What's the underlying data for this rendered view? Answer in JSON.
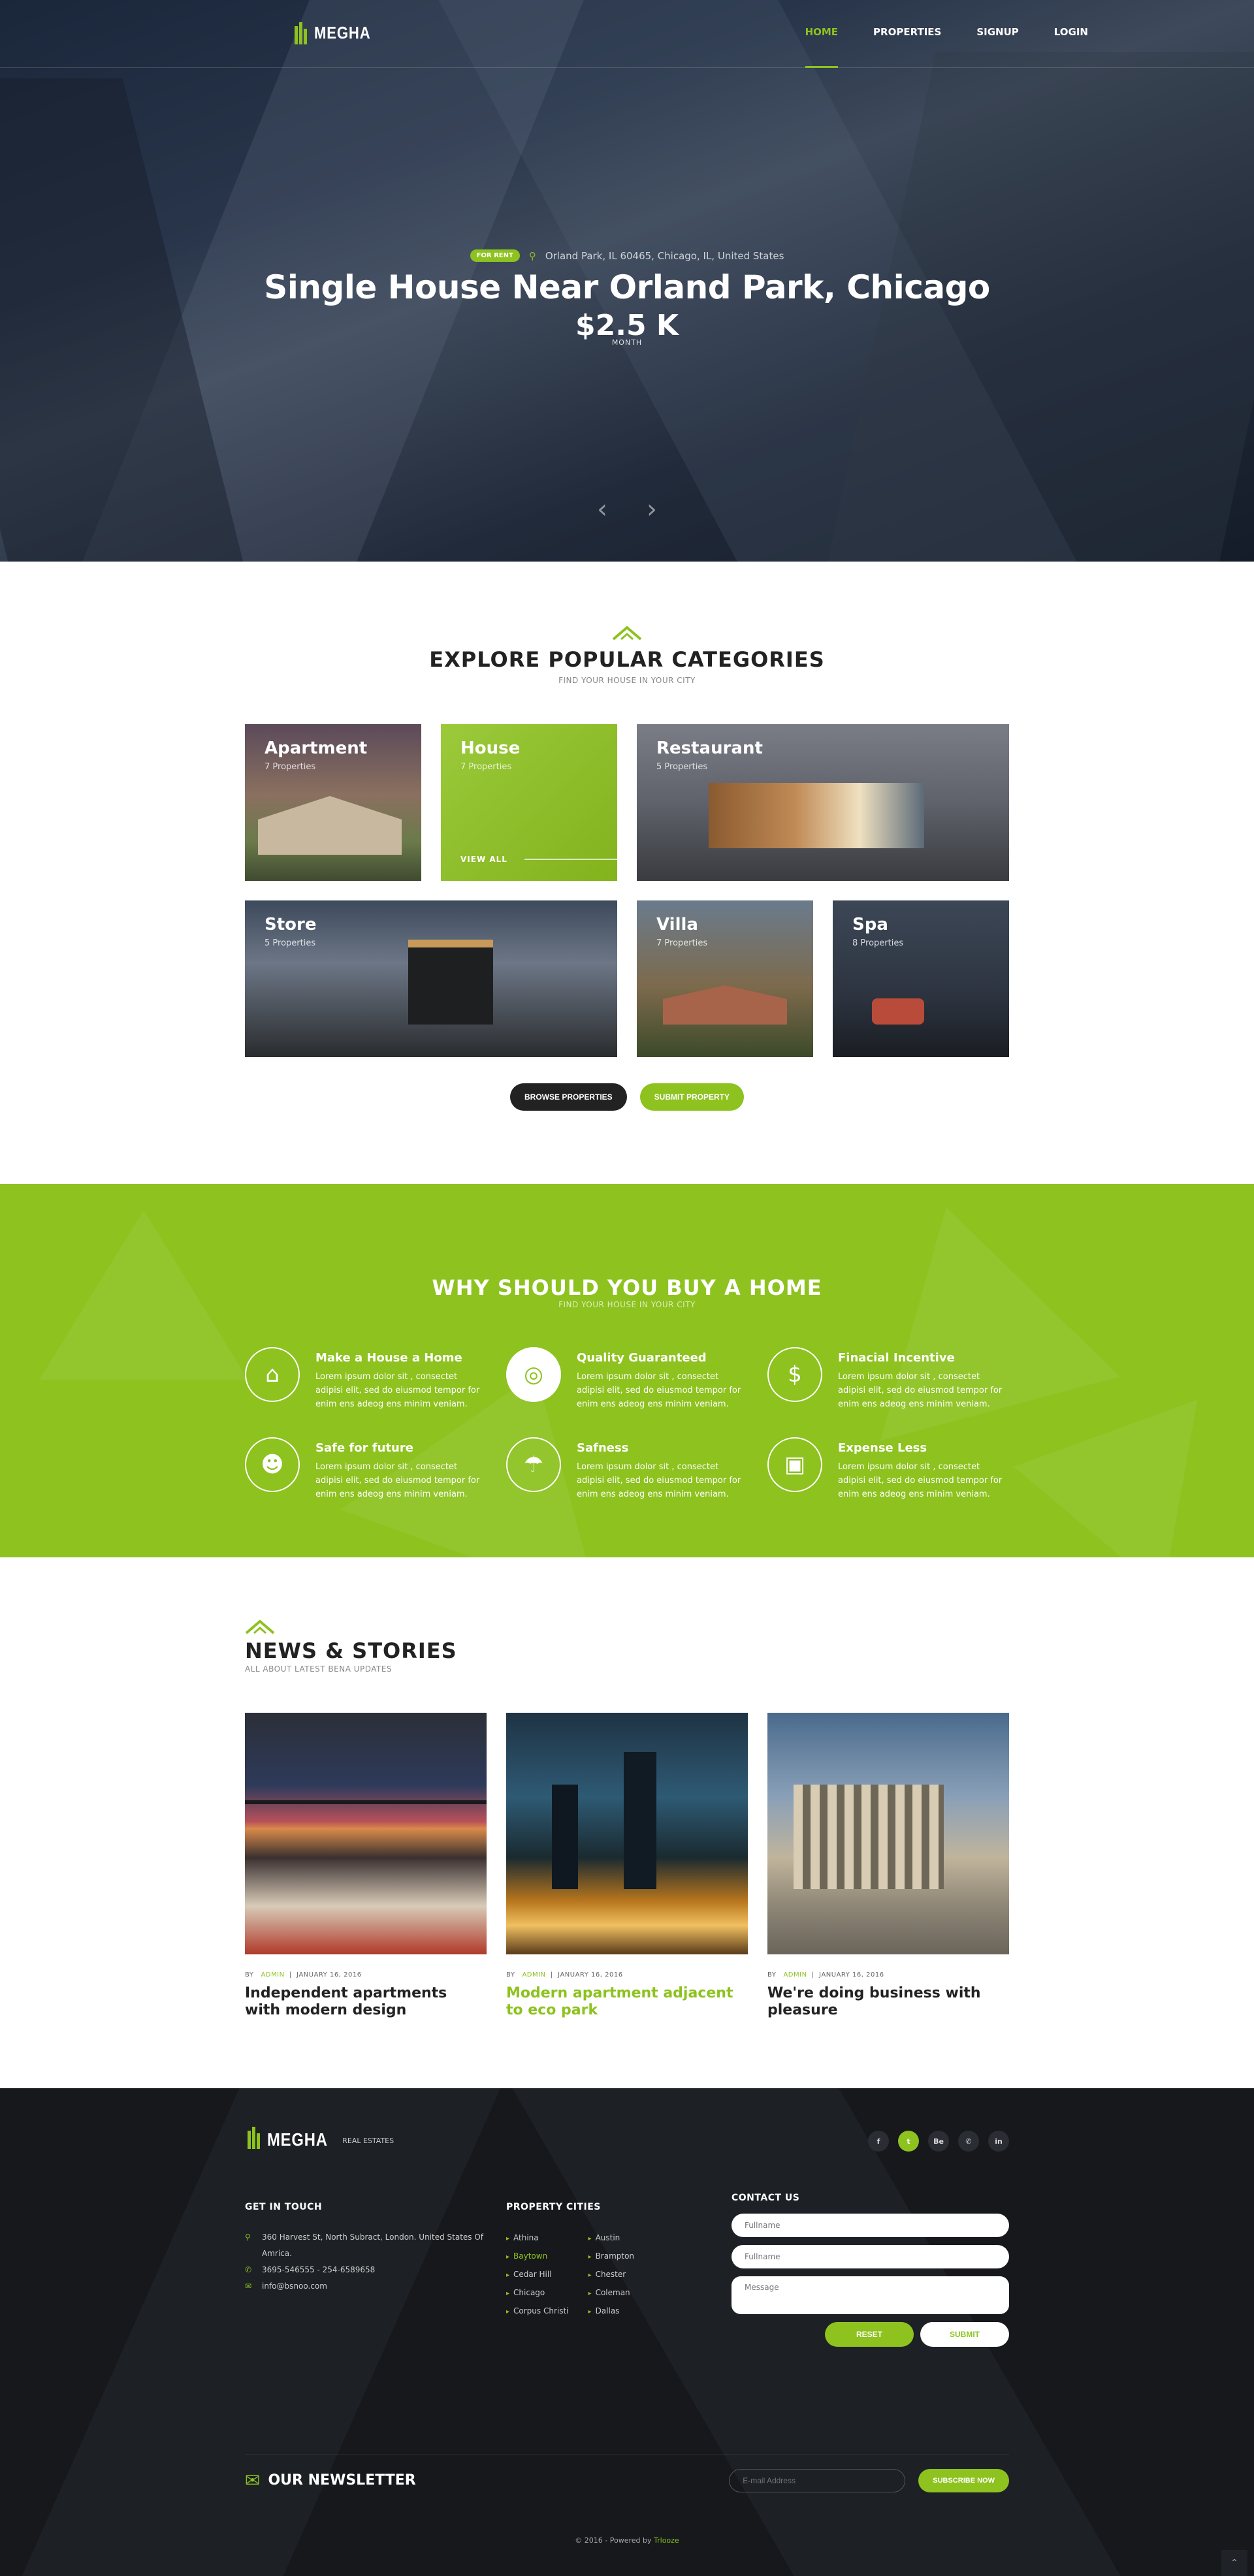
{
  "brand": {
    "name": "MEGHA",
    "accent": "#8dc21f",
    "dark": "#222222"
  },
  "nav": {
    "items": [
      {
        "label": "HOME",
        "active": true
      },
      {
        "label": "PROPERTIES"
      },
      {
        "label": "SIGNUP"
      },
      {
        "label": "LOGIN"
      }
    ]
  },
  "hero": {
    "badge": "FOR RENT",
    "location": "Orland Park, IL 60465, Chicago, IL, United States",
    "title": "Single House Near Orland Park, Chicago",
    "price": "$2.5 K",
    "unit": "MONTH",
    "prev_icon": "chevron-left-icon",
    "next_icon": "chevron-right-icon"
  },
  "categories": {
    "title": "EXPLORE POPULAR CATEGORIES",
    "subtitle": "FIND YOUR HOUSE IN YOUR CITY",
    "tiles": [
      {
        "name": "Apartment",
        "count": "7 Properties"
      },
      {
        "name": "House",
        "count": "7 Properties",
        "cta": "VIEW ALL"
      },
      {
        "name": "Restaurant",
        "count": "5 Properties"
      },
      {
        "name": "Store",
        "count": "5 Properties"
      },
      {
        "name": "Villa",
        "count": "7 Properties"
      },
      {
        "name": "Spa",
        "count": "8 Properties"
      }
    ],
    "browse_label": "BROWSE PROPERTIES",
    "submit_label": "SUBMIT PROPERTY"
  },
  "why": {
    "title": "WHY SHOULD YOU BUY A HOME",
    "subtitle": "FIND YOUR HOUSE IN YOUR CITY",
    "features": [
      {
        "icon": "home-icon",
        "title": "Make a House a Home",
        "text": "Lorem ipsum dolor sit , consectet adipisi elit, sed do eiusmod tempor for enim ens adeog ens minim veniam."
      },
      {
        "icon": "lifebuoy-icon",
        "title": "Quality Guaranteed",
        "text": "Lorem ipsum dolor sit , consectet adipisi elit, sed do eiusmod tempor for enim ens adeog ens minim veniam."
      },
      {
        "icon": "dollar-icon",
        "title": "Finacial Incentive",
        "text": "Lorem ipsum dolor sit , consectet adipisi elit, sed do eiusmod tempor for enim ens adeog ens minim veniam."
      },
      {
        "icon": "users-icon",
        "title": "Safe for future",
        "text": "Lorem ipsum dolor sit , consectet adipisi elit, sed do eiusmod tempor for enim ens adeog ens minim veniam."
      },
      {
        "icon": "umbrella-icon",
        "title": "Safness",
        "text": "Lorem ipsum dolor sit , consectet adipisi elit, sed do eiusmod tempor for enim ens adeog ens minim veniam."
      },
      {
        "icon": "money-icon",
        "title": "Expense Less",
        "text": "Lorem ipsum dolor sit , consectet adipisi elit, sed do eiusmod tempor for enim ens adeog ens minim veniam."
      }
    ]
  },
  "news": {
    "title": "NEWS & STORIES",
    "subtitle": "ALL ABOUT LATEST BENA UPDATES",
    "posts": [
      {
        "by": "BY",
        "author": "ADMIN",
        "date": "JANUARY 16, 2016",
        "title": "Independent apartments with modern design"
      },
      {
        "by": "BY",
        "author": "ADMIN",
        "date": "JANUARY 16, 2016",
        "title": "Modern apartment adjacent to eco park"
      },
      {
        "by": "BY",
        "author": "ADMIN",
        "date": "JANUARY 16, 2016",
        "title": "We're doing business with pleasure"
      }
    ]
  },
  "footer": {
    "logo": "MEGHA",
    "logo_sub": "REAL ESTATES",
    "social": [
      "f",
      "t",
      "Be",
      "✆",
      "in"
    ],
    "contact_title": "GET IN TOUCH",
    "address": "360 Harvest St, North Subract, London. United States Of Amrica.",
    "phone": "3695-546555 - 254-6589658",
    "email": "info@bsnoo.com",
    "cities_title": "PROPERTY CITIES",
    "cities_a": [
      "Athina",
      "Baytown",
      "Cedar Hill",
      "Chicago",
      "Corpus Christi"
    ],
    "cities_b": [
      "Austin",
      "Brampton",
      "Chester",
      "Coleman",
      "Dallas"
    ],
    "form_title": "CONTACT US",
    "form": {
      "p1": "Fullname",
      "p2": "Fullname",
      "p3": "Message",
      "reset": "RESET",
      "submit": "SUBMIT"
    },
    "newsletter_title": "OUR NEWSLETTER",
    "newsletter_placeholder": "E-mail Address",
    "newsletter_button": "SUBSCRIBE NOW",
    "copyright_prefix": "© 2016 - Powered by",
    "copyright_link": "Trlooze"
  }
}
